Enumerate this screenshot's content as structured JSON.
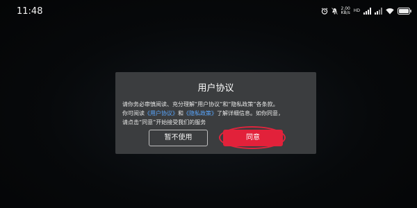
{
  "status_bar": {
    "time": "11:48",
    "net_speed_value": "2.00",
    "net_speed_unit": "KB/s",
    "net_type": "HD",
    "battery_level": "full",
    "icons": [
      "alarm-icon",
      "mute-icon",
      "signal-icon",
      "signal-icon",
      "wifi-icon",
      "battery-icon"
    ]
  },
  "dialog": {
    "title": "用户协议",
    "body": {
      "line1": "请你务必审慎阅读、充分理解“用户协议”和“隐私政策”各条款。",
      "line2_prefix": "你可阅读",
      "link_user_agreement": "《用户协议》",
      "line2_and": "和",
      "link_privacy_policy": "《隐私政策》",
      "line2_suffix": "了解详细信息。如你同意，",
      "line3": "请点击“同意”开始接受我们的服务"
    },
    "buttons": {
      "decline": "暂不使用",
      "agree": "同意"
    }
  },
  "colors": {
    "background": "#050607",
    "dialog_bg": "#3b3d3f",
    "link": "#5aa7ff",
    "agree_button": "#e2213a",
    "highlight": "#e0243c"
  }
}
